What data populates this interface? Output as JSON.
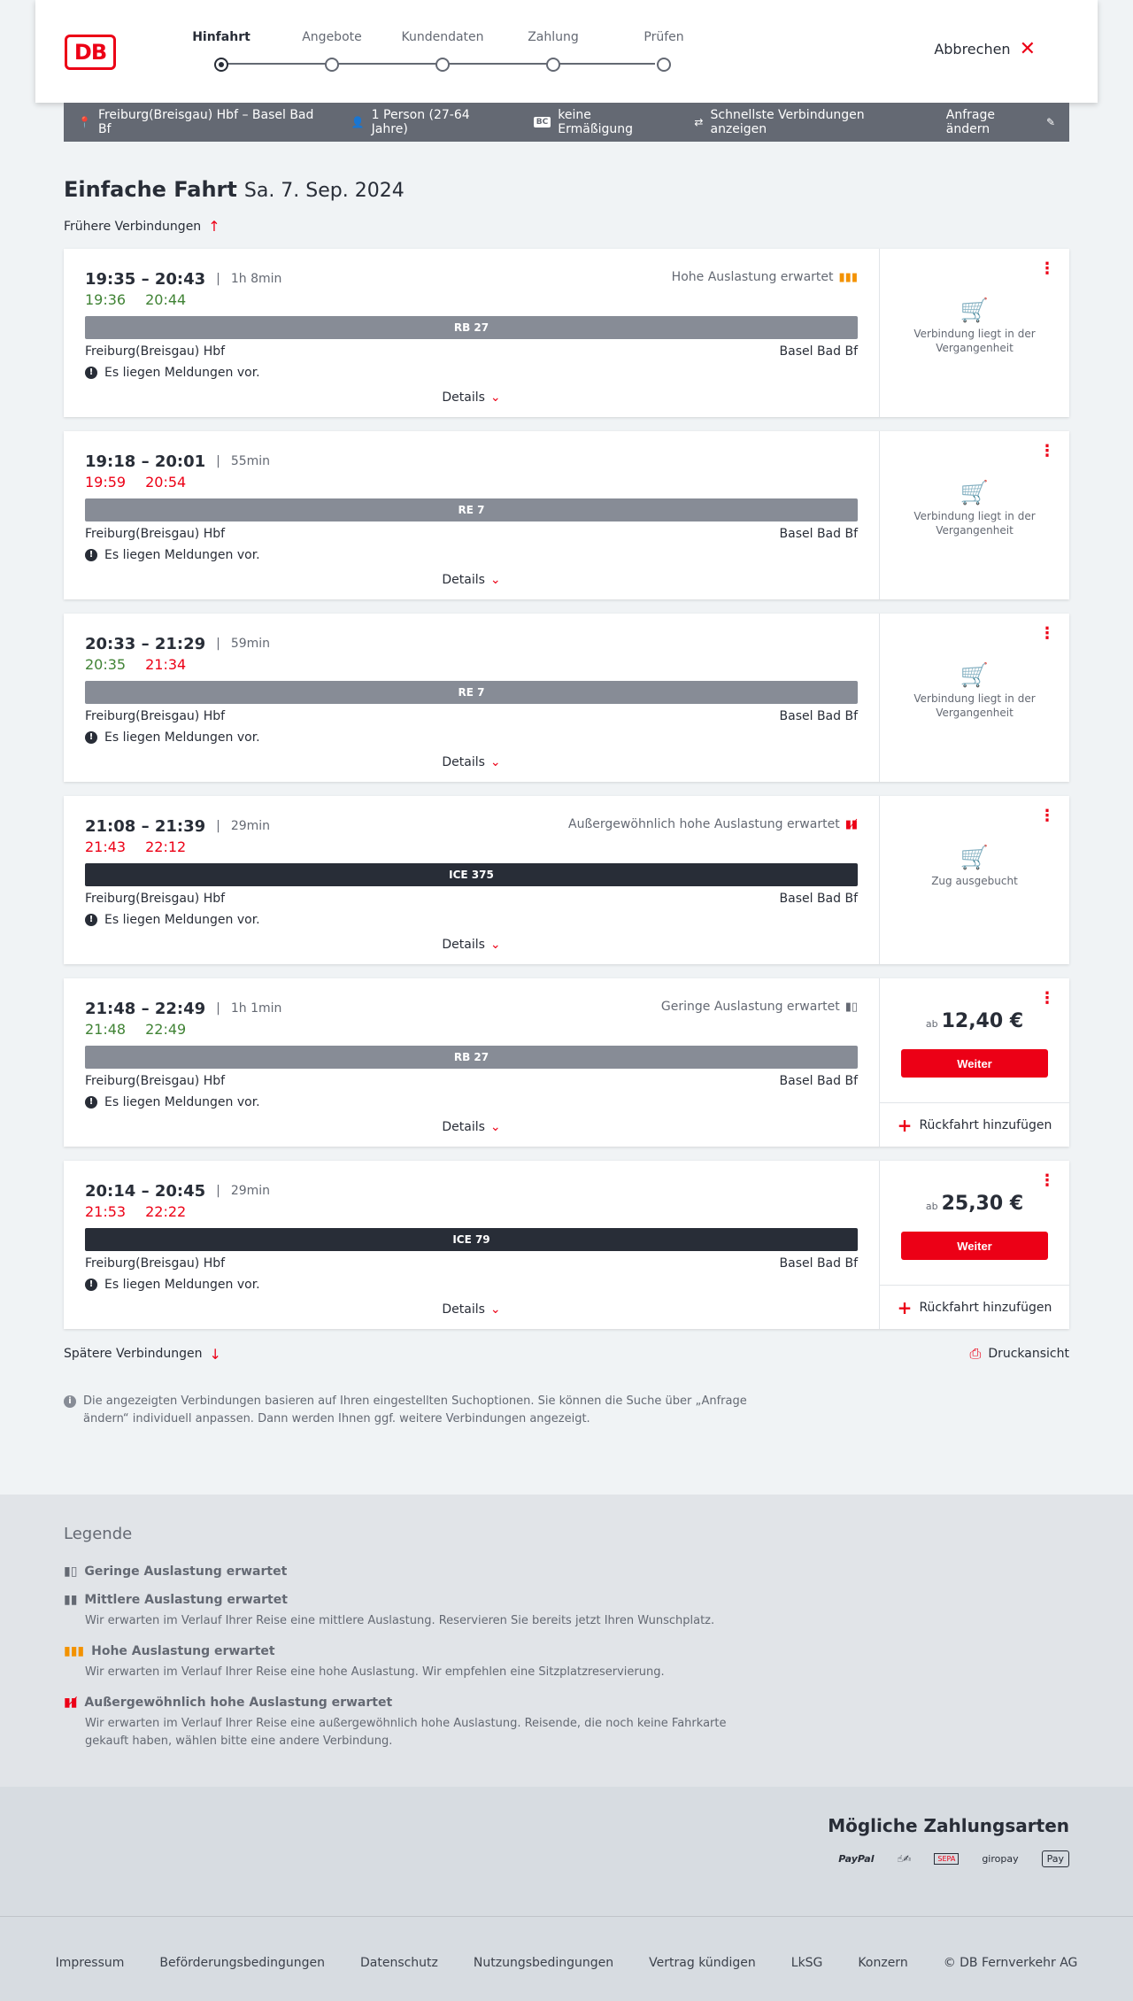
{
  "header": {
    "logo": "DB",
    "steps": [
      "Hinfahrt",
      "Angebote",
      "Kundendaten",
      "Zahlung",
      "Prüfen"
    ],
    "cancel_label": "Abbrechen"
  },
  "query": {
    "route": "Freiburg(Breisgau) Hbf – Basel Bad Bf",
    "persons": "1 Person (27-64 Jahre)",
    "bc_badge": "BC",
    "discount": "keine Ermäßigung",
    "fastest": "Schnellste Verbindungen anzeigen",
    "change": "Anfrage ändern"
  },
  "page": {
    "title": "Einfache Fahrt",
    "date": "Sa. 7. Sep. 2024",
    "earlier": "Frühere Verbindungen",
    "later": "Spätere Verbindungen",
    "print": "Druckansicht",
    "info": "Die angezeigten Verbindungen basieren auf Ihren eingestellten Suchoptionen. Sie können die Suche über „Anfrage ändern“ individuell anpassen. Dann werden Ihnen ggf. weitere Verbindungen angezeigt.",
    "details_label": "Details",
    "messages_label": "Es liegen Meldungen vor.",
    "weiter_label": "Weiter",
    "rueckfahrt_label": "Rückfahrt hinzufügen",
    "ab_label": "ab"
  },
  "connections": [
    {
      "times": "19:35 – 20:43",
      "duration": "1h 8min",
      "rt_dep": "19:36",
      "rt_arr": "20:44",
      "load": "Hohe Auslastung erwartet",
      "train": "RB 27",
      "from": "Freiburg(Breisgau) Hbf",
      "to": "Basel Bad Bf",
      "status": "Verbindung liegt in der Vergangenheit"
    },
    {
      "times": "19:18 – 20:01",
      "duration": "55min",
      "rt_dep": "19:59",
      "rt_arr": "20:54",
      "load": "",
      "train": "RE 7",
      "from": "Freiburg(Breisgau) Hbf",
      "to": "Basel Bad Bf",
      "status": "Verbindung liegt in der Vergangenheit"
    },
    {
      "times": "20:33 – 21:29",
      "duration": "59min",
      "rt_dep": "20:35",
      "rt_arr": "21:34",
      "load": "",
      "train": "RE 7",
      "from": "Freiburg(Breisgau) Hbf",
      "to": "Basel Bad Bf",
      "status": "Verbindung liegt in der Vergangenheit"
    },
    {
      "times": "21:08 – 21:39",
      "duration": "29min",
      "rt_dep": "21:43",
      "rt_arr": "22:12",
      "load": "Außergewöhnlich hohe Auslastung erwartet",
      "train": "ICE 375",
      "from": "Freiburg(Breisgau) Hbf",
      "to": "Basel Bad Bf",
      "status": "Zug ausgebucht"
    },
    {
      "times": "21:48 – 22:49",
      "duration": "1h 1min",
      "rt_dep": "21:48",
      "rt_arr": "22:49",
      "load": "Geringe Auslastung erwartet",
      "train": "RB 27",
      "from": "Freiburg(Breisgau) Hbf",
      "to": "Basel Bad Bf",
      "price": "12,40 €"
    },
    {
      "times": "20:14 – 20:45",
      "duration": "29min",
      "rt_dep": "21:53",
      "rt_arr": "22:22",
      "load": "",
      "train": "ICE 79",
      "from": "Freiburg(Breisgau) Hbf",
      "to": "Basel Bad Bf",
      "price": "25,30 €"
    }
  ],
  "legend": {
    "title": "Legende",
    "items": [
      {
        "title": "Geringe Auslastung erwartet",
        "desc": ""
      },
      {
        "title": "Mittlere Auslastung erwartet",
        "desc": "Wir erwarten im Verlauf Ihrer Reise eine mittlere Auslastung. Reservieren Sie bereits jetzt Ihren Wunschplatz."
      },
      {
        "title": "Hohe Auslastung erwartet",
        "desc": "Wir erwarten im Verlauf Ihrer Reise eine hohe Auslastung. Wir empfehlen eine Sitzplatzreservierung."
      },
      {
        "title": "Außergewöhnlich hohe Auslastung erwartet",
        "desc": "Wir erwarten im Verlauf Ihrer Reise eine außergewöhnlich hohe Auslastung. Reisende, die noch keine Fahrkarte gekauft haben, wählen bitte eine andere Verbindung."
      }
    ]
  },
  "payments": {
    "title": "Mögliche Zahlungsarten",
    "methods": [
      "PayPal",
      "SEPA",
      "giropay",
      "Pay"
    ]
  },
  "footer": {
    "links": [
      "Impressum",
      "Beförderungsbedingungen",
      "Datenschutz",
      "Nutzungsbedingungen",
      "Vertrag kündigen",
      "LkSG",
      "Konzern",
      "© DB Fernverkehr AG"
    ]
  },
  "colors": {
    "brand": "#ec0016",
    "ontime": "#408335",
    "delay": "#ec0016",
    "bar_regional": "#878c96",
    "bar_ice": "#282d37",
    "load_high": "#f39200"
  }
}
